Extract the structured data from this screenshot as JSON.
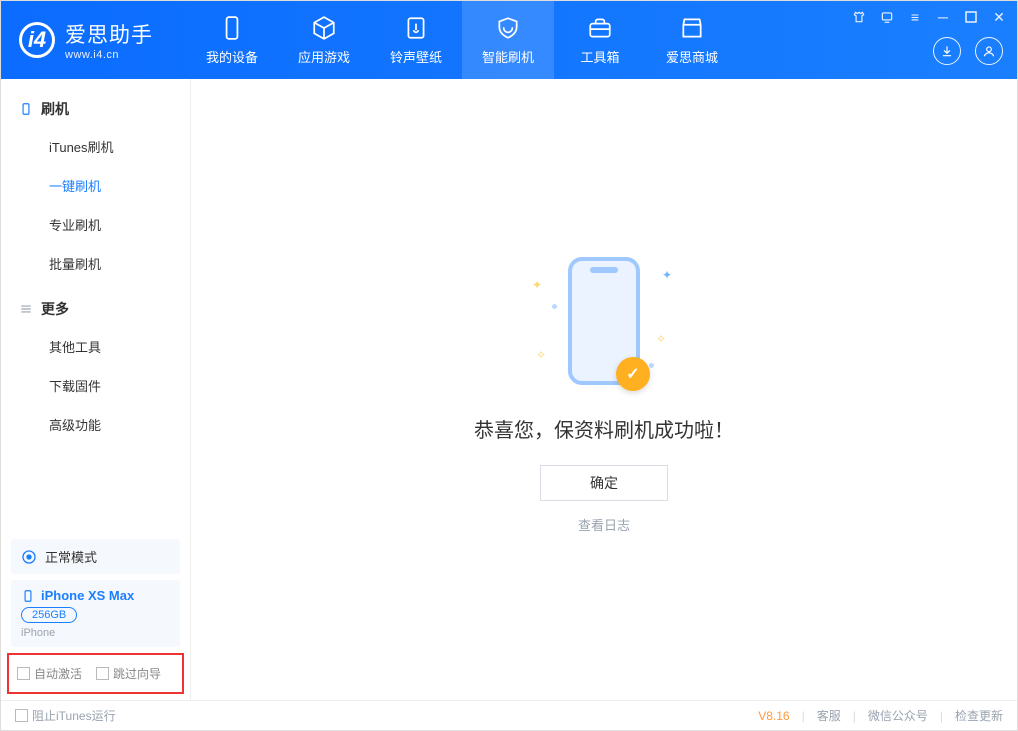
{
  "app": {
    "title": "爱思助手",
    "sub": "www.i4.cn"
  },
  "tabs": {
    "device": "我的设备",
    "apps": "应用游戏",
    "ring": "铃声壁纸",
    "flash": "智能刷机",
    "tools": "工具箱",
    "store": "爱思商城"
  },
  "sidebar": {
    "g1": "刷机",
    "items1": {
      "itunes": "iTunes刷机",
      "one": "一键刷机",
      "pro": "专业刷机",
      "batch": "批量刷机"
    },
    "g2": "更多",
    "items2": {
      "other": "其他工具",
      "fw": "下载固件",
      "adv": "高级功能"
    },
    "mode": "正常模式",
    "device_name": "iPhone XS Max",
    "storage": "256GB",
    "device_type": "iPhone",
    "opt_auto": "自动激活",
    "opt_skip": "跳过向导"
  },
  "main": {
    "title": "恭喜您，保资料刷机成功啦！",
    "ok": "确定",
    "log": "查看日志"
  },
  "footer": {
    "block_itunes": "阻止iTunes运行",
    "version": "V8.16",
    "cs": "客服",
    "wechat": "微信公众号",
    "update": "检查更新"
  }
}
